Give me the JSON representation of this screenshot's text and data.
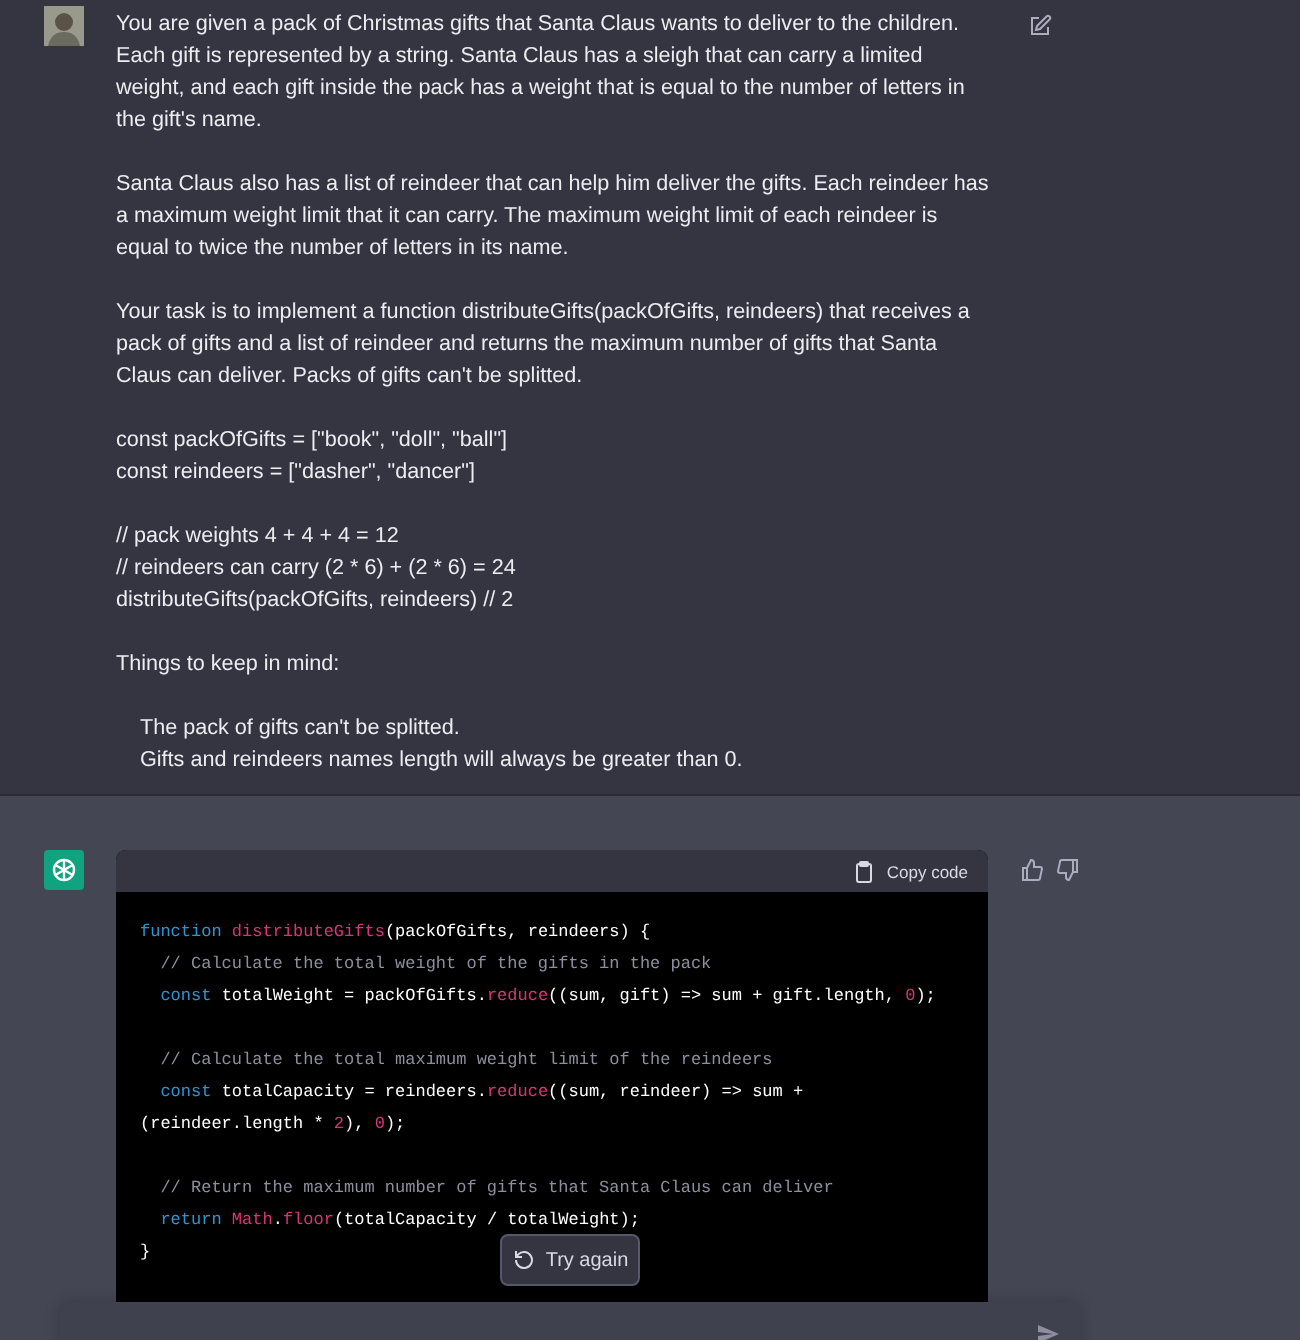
{
  "user_message": {
    "paragraphs": [
      {
        "kind": "text",
        "text": "You are given a pack of Christmas gifts that Santa Claus wants to deliver to the children. Each gift is represented by a string. Santa Claus has a sleigh that can carry a limited weight, and each gift inside the pack has a weight that is equal to the number of letters in the gift's name."
      },
      {
        "kind": "text",
        "text": "Santa Claus also has a list of reindeer that can help him deliver the gifts. Each reindeer has a maximum weight limit that it can carry. The maximum weight limit of each reindeer is equal to twice the number of letters in its name."
      },
      {
        "kind": "text",
        "text": "Your task is to implement a function distributeGifts(packOfGifts, reindeers) that receives a pack of gifts and a list of reindeer and returns the maximum number of gifts that Santa Claus can deliver. Packs of gifts can't be splitted."
      },
      {
        "kind": "lines",
        "lines": [
          "const packOfGifts = [\"book\", \"doll\", \"ball\"]",
          "const reindeers = [\"dasher\", \"dancer\"]"
        ]
      },
      {
        "kind": "lines",
        "lines": [
          "// pack weights 4 + 4 + 4 = 12",
          "// reindeers can carry (2 * 6) + (2 * 6) = 24",
          "distributeGifts(packOfGifts, reindeers) // 2"
        ]
      },
      {
        "kind": "lines",
        "lines": [
          "Things to keep in mind:"
        ]
      },
      {
        "kind": "list",
        "lines": [
          "The pack of gifts can't be splitted.",
          "Gifts and reindeers names length will always be greater than 0."
        ]
      }
    ]
  },
  "assistant_message": {
    "code_block": {
      "copy_label": "Copy code",
      "lines": [
        [
          {
            "kind": "keyword",
            "text": "function "
          },
          {
            "kind": "function",
            "text": "distributeGifts"
          },
          {
            "kind": "plain",
            "text": "(packOfGifts, reindeers) {"
          }
        ],
        [
          {
            "kind": "comment",
            "text": "  // Calculate the total weight of the gifts in the pack"
          }
        ],
        [
          {
            "kind": "keyword",
            "text": "  const "
          },
          {
            "kind": "plain",
            "text": "totalWeight = packOfGifts."
          },
          {
            "kind": "function",
            "text": "reduce"
          },
          {
            "kind": "plain",
            "text": "((sum, gift) => sum + gift.length, "
          },
          {
            "kind": "number",
            "text": "0"
          },
          {
            "kind": "plain",
            "text": ");"
          }
        ],
        [
          {
            "kind": "gap"
          },
          {
            "kind": "comment",
            "text": "  // Calculate the total maximum weight limit of the reindeers"
          }
        ],
        [
          {
            "kind": "keyword",
            "text": "  const "
          },
          {
            "kind": "plain",
            "text": "totalCapacity = reindeers."
          },
          {
            "kind": "function",
            "text": "reduce"
          },
          {
            "kind": "plain",
            "text": "((sum, reindeer) => sum +"
          }
        ],
        [
          {
            "kind": "plain",
            "text": "(reindeer.length * "
          },
          {
            "kind": "number",
            "text": "2"
          },
          {
            "kind": "plain",
            "text": "), "
          },
          {
            "kind": "number",
            "text": "0"
          },
          {
            "kind": "plain",
            "text": ");"
          }
        ],
        [
          {
            "kind": "gap"
          },
          {
            "kind": "comment",
            "text": "  // Return the maximum number of gifts that Santa Claus can deliver"
          }
        ],
        [
          {
            "kind": "keyword",
            "text": "  return "
          },
          {
            "kind": "function",
            "text": "Math"
          },
          {
            "kind": "plain",
            "text": "."
          },
          {
            "kind": "function",
            "text": "floor"
          },
          {
            "kind": "plain",
            "text": "(totalCapacity / totalWeight);"
          }
        ],
        [
          {
            "kind": "plain",
            "text": "}"
          }
        ]
      ]
    }
  },
  "try_again_button": "Try again"
}
